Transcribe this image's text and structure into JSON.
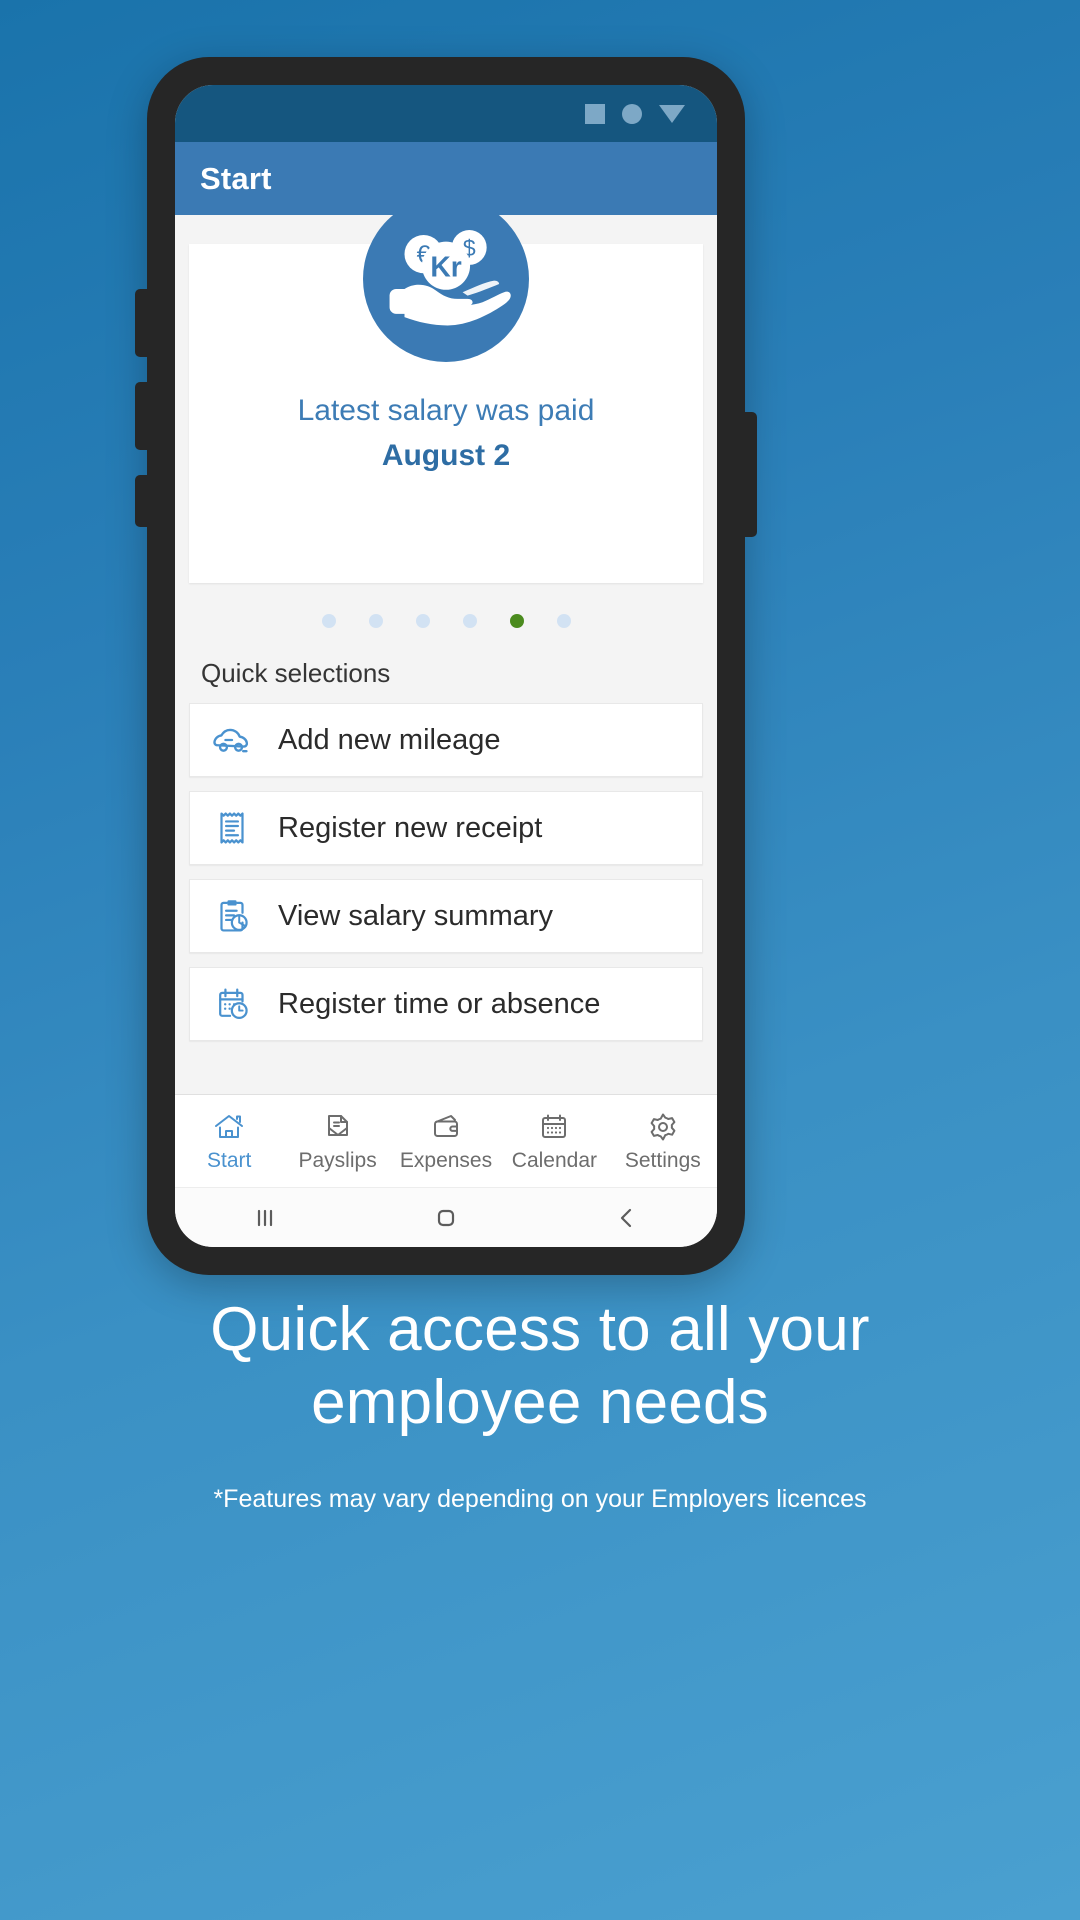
{
  "status_bar": {
    "icons": [
      "square-icon",
      "circle-icon",
      "triangle-down-icon"
    ],
    "background": "#15567f"
  },
  "app_bar": {
    "title": "Start",
    "background": "#3b7ab4"
  },
  "hero": {
    "icon_name": "hand-with-coins-icon",
    "coins": [
      "€",
      "Kr",
      "$"
    ],
    "line1": "Latest salary was paid",
    "line2": "August 2",
    "text_color": "#3d7cb5"
  },
  "carousel": {
    "total_dots": 6,
    "active_index": 4,
    "active_color": "#4b8b1e",
    "inactive_color": "#d2e2f3"
  },
  "quick_selections": {
    "label": "Quick selections",
    "items": [
      {
        "label": "Add new mileage",
        "icon": "car-icon"
      },
      {
        "label": "Register new receipt",
        "icon": "receipt-icon"
      },
      {
        "label": "View salary summary",
        "icon": "clipboard-chart-icon"
      },
      {
        "label": "Register time or absence",
        "icon": "calendar-clock-icon"
      }
    ],
    "icon_color": "#4a92cf"
  },
  "bottom_nav": {
    "active_index": 0,
    "active_color": "#4a92cf",
    "items": [
      {
        "label": "Start",
        "icon": "home-icon"
      },
      {
        "label": "Payslips",
        "icon": "document-envelope-icon"
      },
      {
        "label": "Expenses",
        "icon": "wallet-icon"
      },
      {
        "label": "Calendar",
        "icon": "calendar-icon"
      },
      {
        "label": "Settings",
        "icon": "gear-icon"
      }
    ]
  },
  "android_nav": {
    "recent": "recent-apps-icon",
    "home": "home-square-icon",
    "back": "back-chevron-icon"
  },
  "caption": {
    "headline": "Quick access to all your employee needs",
    "footnote": "*Features may vary depending on your Employers licences"
  }
}
